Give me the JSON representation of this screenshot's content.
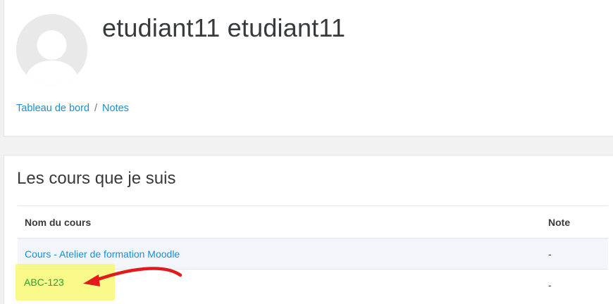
{
  "profile": {
    "fullname": "etudiant11 etudiant11",
    "avatar_icon": "user-avatar-icon"
  },
  "breadcrumb": [
    {
      "label": "Tableau de bord"
    },
    {
      "label": "Notes"
    }
  ],
  "breadcrumb_separator": "/",
  "courses_section": {
    "title": "Les cours que je suis",
    "columns": [
      "Nom du cours",
      "Note"
    ],
    "rows": [
      {
        "course": "Cours - Atelier de formation Moodle",
        "grade": "-"
      },
      {
        "course": "ABC-123",
        "grade": "-"
      }
    ]
  },
  "annotation": {
    "highlight_color": "#f8f864",
    "arrow_color": "#e21a1a",
    "highlighted_link_color": "#2ea02e",
    "arrow_icon": "red-arrow-icon"
  },
  "colors": {
    "link": "#1a8fd4",
    "text": "#373a3c",
    "background": "#f2f2f2"
  }
}
